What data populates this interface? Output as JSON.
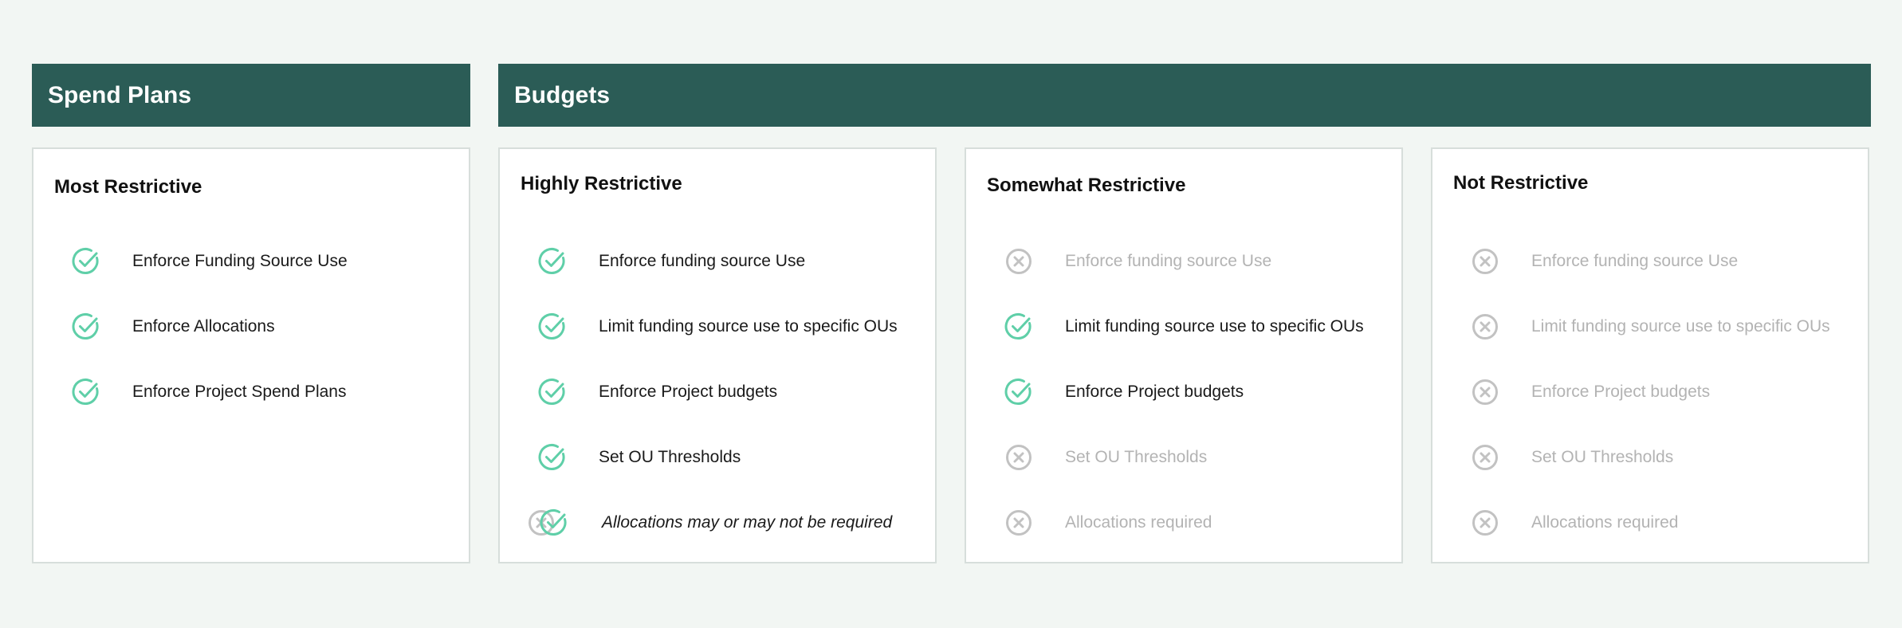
{
  "spend_plans": {
    "header": "Spend Plans",
    "card": {
      "title": "Most Restrictive",
      "items": [
        {
          "label": "Enforce Funding Source Use",
          "state": "check"
        },
        {
          "label": "Enforce Allocations",
          "state": "check"
        },
        {
          "label": "Enforce Project Spend Plans",
          "state": "check"
        }
      ]
    }
  },
  "budgets": {
    "header": "Budgets",
    "cards": [
      {
        "title": "Highly Restrictive",
        "items": [
          {
            "label": "Enforce funding source Use",
            "state": "check"
          },
          {
            "label": "Limit funding source use to specific OUs",
            "state": "check"
          },
          {
            "label": "Enforce Project budgets",
            "state": "check"
          },
          {
            "label": "Set OU Thresholds",
            "state": "check"
          },
          {
            "label": "Allocations may or may not be required",
            "state": "both"
          }
        ]
      },
      {
        "title": "Somewhat Restrictive",
        "items": [
          {
            "label": "Enforce funding source Use",
            "state": "x"
          },
          {
            "label": "Limit funding source use to specific OUs",
            "state": "check"
          },
          {
            "label": "Enforce Project budgets",
            "state": "check"
          },
          {
            "label": "Set OU Thresholds",
            "state": "x"
          },
          {
            "label": "Allocations required",
            "state": "x"
          }
        ]
      },
      {
        "title": "Not Restrictive",
        "items": [
          {
            "label": "Enforce funding source Use",
            "state": "x"
          },
          {
            "label": "Limit funding source use to specific OUs",
            "state": "x"
          },
          {
            "label": "Enforce Project budgets",
            "state": "x"
          },
          {
            "label": "Set OU Thresholds",
            "state": "x"
          },
          {
            "label": "Allocations required",
            "state": "x"
          }
        ]
      }
    ]
  },
  "colors": {
    "header_bg": "#2b5c56",
    "check": "#5fcfa8",
    "x": "#c2c2c2",
    "page_bg": "#f2f6f3"
  }
}
